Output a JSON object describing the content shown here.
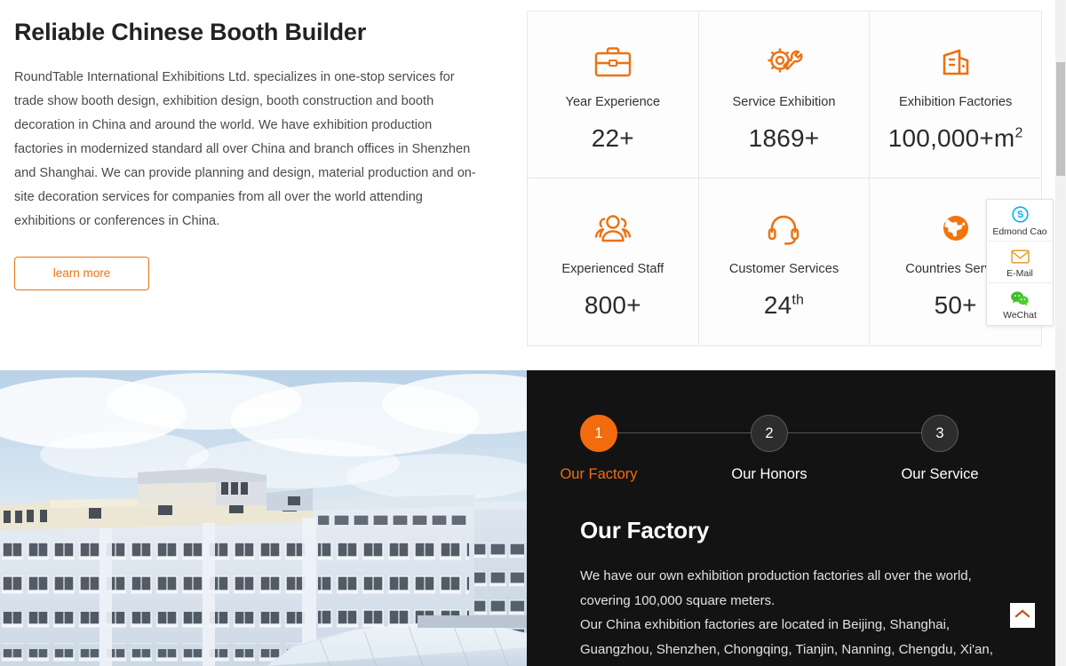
{
  "intro": {
    "title": "Reliable Chinese Booth Builder",
    "paragraph": "RoundTable International Exhibitions Ltd. specializes in one-stop services for trade show booth design, exhibition design, booth construction and booth decoration in China and around the world. We have exhibition production factories in modernized standard all over China and branch offices in Shenzhen and Shanghai. We can provide planning and design, material production and on-site decoration services for companies from all over the world attending exhibitions or conferences in China.",
    "cta_label": "learn more"
  },
  "stats": [
    {
      "icon": "briefcase-icon",
      "label": "Year Experience",
      "value": "22+",
      "sup": ""
    },
    {
      "icon": "gear-wrench-icon",
      "label": "Service Exhibition",
      "value": "1869+",
      "sup": ""
    },
    {
      "icon": "factory-building-icon",
      "label": "Exhibition Factories",
      "value": "100,000+m",
      "sup": "2"
    },
    {
      "icon": "people-group-icon",
      "label": "Experienced Staff",
      "value": "800+",
      "sup": ""
    },
    {
      "icon": "headset-icon",
      "label": "Customer Services",
      "value": "24",
      "sup": "th"
    },
    {
      "icon": "globe-icon",
      "label": "Countries Served",
      "value": "50+",
      "sup": ""
    }
  ],
  "showcase": {
    "steps": [
      {
        "number": "1",
        "label": "Our Factory",
        "active": true
      },
      {
        "number": "2",
        "label": "Our Honors",
        "active": false
      },
      {
        "number": "3",
        "label": "Our Service",
        "active": false
      }
    ],
    "heading": "Our Factory",
    "body_line_1": "We have our own exhibition production factories all over the world, covering 100,000 square meters.",
    "body_line_2": "Our China exhibition factories are located in Beijing, Shanghai, Guangzhou, Shenzhen, Chongqing, Tianjin, Nanning, Chengdu, Xi'an,"
  },
  "contact_widget": [
    {
      "icon": "skype-icon",
      "label": "Edmond Cao"
    },
    {
      "icon": "email-icon",
      "label": "E-Mail"
    },
    {
      "icon": "wechat-icon",
      "label": "WeChat"
    }
  ],
  "back_to_top": {
    "icon": "chevron-up-icon"
  },
  "colors": {
    "accent_orange": "#ec7211",
    "step_orange": "#f26b0f",
    "dark_panel": "#131313",
    "skype_blue": "#00aff0",
    "wechat_green": "#3dbe29"
  }
}
